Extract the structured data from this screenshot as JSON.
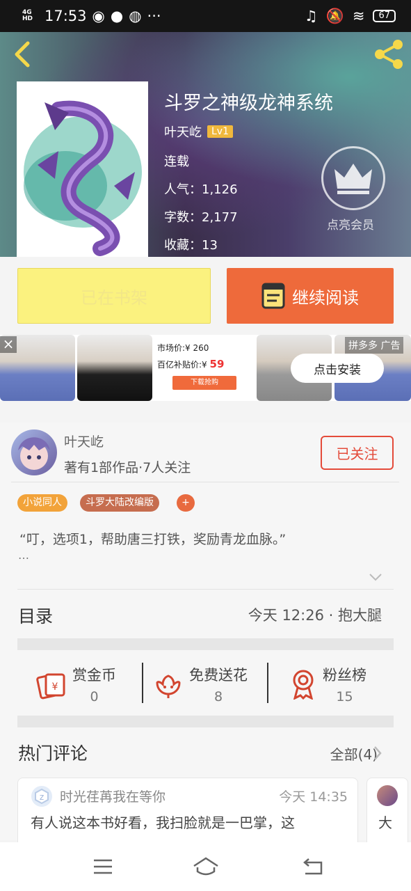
{
  "status_bar": {
    "network": "4G HD",
    "time": "17:53",
    "battery": "67"
  },
  "book": {
    "title": "斗罗之神级龙神系统",
    "author": "叶天屹",
    "level": "Lv1",
    "status": "连载",
    "popularity": "人气：1,126",
    "word_count": "字数：2,177",
    "favorites": "收藏：13"
  },
  "vip": {
    "label": "点亮会员"
  },
  "actions": {
    "shelf_label": "已在书架",
    "read_label": "继续阅读"
  },
  "ad": {
    "market_price": "市场价:¥ 260",
    "subsidy_price": "百亿补贴价:¥",
    "subsidy_value": "59",
    "buy_label": "下载抢购",
    "tag": "拼多多  广告",
    "install_label": "点击安装",
    "close": "×"
  },
  "author_card": {
    "name": "叶天屹",
    "info": "著有1部作品·7人关注",
    "follow_label": "已关注"
  },
  "tags": [
    "小说同人",
    "斗罗大陆改编版",
    "+"
  ],
  "excerpt": {
    "text": "“叮，选项1，帮助唐三打铁，奖励青龙血脉。”",
    "ellipsis": "…"
  },
  "toc": {
    "title": "目录",
    "status": "今天 12:26 · 抱大腿"
  },
  "rewards": [
    {
      "label": "赏金币",
      "value": "0",
      "icon": "coin-envelope-icon"
    },
    {
      "label": "免费送花",
      "value": "8",
      "icon": "flower-icon"
    },
    {
      "label": "粉丝榜",
      "value": "15",
      "icon": "medal-icon"
    }
  ],
  "comments": {
    "title": "热门评论",
    "all_label": "全部(4)",
    "items": [
      {
        "user": "时光荏苒我在等你",
        "time": "今天 14:35",
        "text": "有人说这本书好看，我扫脸就是一巴掌，这"
      },
      {
        "text": "大"
      }
    ]
  },
  "colors": {
    "accent": "#ee6a3b",
    "shelf": "#fbf27f",
    "follow": "#e44b3a",
    "tag_orange": "#f2a33a",
    "tag_brown": "#c66d4f"
  }
}
